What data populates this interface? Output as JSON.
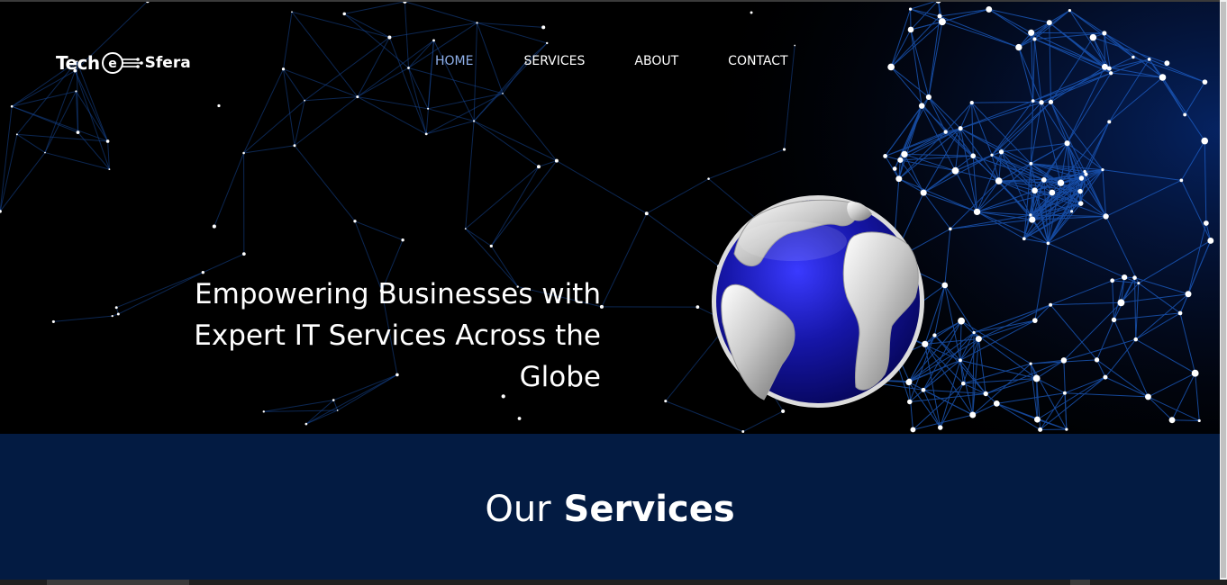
{
  "brand": {
    "logo_part1": "Tech",
    "logo_part2": "Sfera"
  },
  "nav": {
    "items": [
      {
        "label": "HOME",
        "active": true
      },
      {
        "label": "SERVICES",
        "active": false
      },
      {
        "label": "ABOUT",
        "active": false
      },
      {
        "label": "CONTACT",
        "active": false
      }
    ]
  },
  "hero": {
    "headline_line1": "Empowering Businesses with",
    "headline_line2": "Expert IT Services Across the",
    "headline_line3": "Globe"
  },
  "services": {
    "title_light": "Our",
    "title_bold": "Services"
  },
  "colors": {
    "nav_active": "#8fb0ea",
    "band_bg": "#031b42",
    "network_blue": "#1d6fe0",
    "globe_blue": "#1c1ca0"
  },
  "icons": {
    "logo_emblem": "circuit-e-icon",
    "hero_image": "globe-network-illustration"
  }
}
